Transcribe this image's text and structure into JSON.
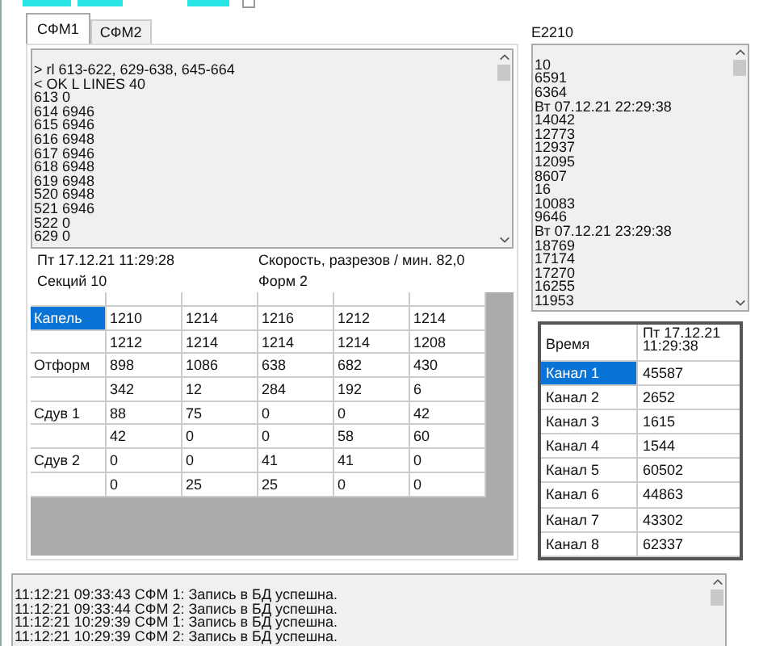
{
  "top_checkbox": {
    "checked": false
  },
  "tabs": [
    {
      "label": "СФМ1",
      "selected": true
    },
    {
      "label": "СФМ2",
      "selected": false
    }
  ],
  "left_log": [
    "> rl 613-622, 629-638, 645-664",
    "< OK L LINES 40",
    "613 0",
    "614 6946",
    "615 6946",
    "616 6948",
    "617 6946",
    "618 6948",
    "619 6948",
    "520 6948",
    "521 6946",
    "522 0",
    "629 0"
  ],
  "timestamp": "Пт 17.12.21 11:29:28",
  "speed": "Скорость, разрезов / мин. 82,0",
  "sections": "Секций 10",
  "forms": "Форм 2",
  "grid_rows": [
    {
      "label": "Капель",
      "selected": true,
      "values": [
        "1210",
        "1214",
        "1216",
        "1212",
        "1214"
      ]
    },
    {
      "selected": false,
      "values": [
        "1212",
        "1214",
        "1214",
        "1214",
        "1208"
      ]
    },
    {
      "label": "Отформ",
      "selected": false,
      "values": [
        "898",
        "1086",
        "638",
        "682",
        "430"
      ]
    },
    {
      "selected": false,
      "values": [
        "342",
        "12",
        "284",
        "192",
        "6"
      ]
    },
    {
      "label": "Сдув 1",
      "selected": false,
      "values": [
        "88",
        "75",
        "0",
        "0",
        "42"
      ]
    },
    {
      "selected": false,
      "values": [
        "42",
        "0",
        "0",
        "58",
        "60"
      ]
    },
    {
      "label": "Сдув 2",
      "selected": false,
      "values": [
        "0",
        "0",
        "41",
        "41",
        "0"
      ]
    },
    {
      "selected": false,
      "values": [
        "0",
        "25",
        "25",
        "0",
        "0"
      ]
    }
  ],
  "right_title": "E2210",
  "right_log": [
    "10",
    "6591",
    "6364",
    "Вт 07.12.21 22:29:38",
    "14042",
    "12773",
    "12937",
    "12095",
    "8607",
    "16",
    "10083",
    "9646",
    "Вт 07.12.21 23:29:38",
    "18769",
    "17174",
    "17270",
    "16255",
    "11953"
  ],
  "channel_header": [
    "Время",
    "Пт 17.12.21 11:29:38"
  ],
  "channels": [
    {
      "name": "Канал 1",
      "value": "45587",
      "selected": true
    },
    {
      "name": "Канал 2",
      "value": "2652",
      "selected": false
    },
    {
      "name": "Канал 3",
      "value": "1615",
      "selected": false
    },
    {
      "name": "Канал 4",
      "value": "1544",
      "selected": false
    },
    {
      "name": "Канал 5",
      "value": "60502",
      "selected": false
    },
    {
      "name": "Канал 6",
      "value": "44863",
      "selected": false
    },
    {
      "name": "Канал 7",
      "value": "43302",
      "selected": false
    },
    {
      "name": "Канал 8",
      "value": "62337",
      "selected": false
    }
  ],
  "bottom_log": [
    "11:12:21 09:33:43 СФМ 1: Запись в БД успешна.",
    "11:12:21 09:33:44 СФМ 2: Запись в БД успешна.",
    "11:12:21 10:29:39 СФМ 1: Запись в БД успешна.",
    "11:12:21 10:29:39 СФМ 2: Запись в БД успешна."
  ]
}
